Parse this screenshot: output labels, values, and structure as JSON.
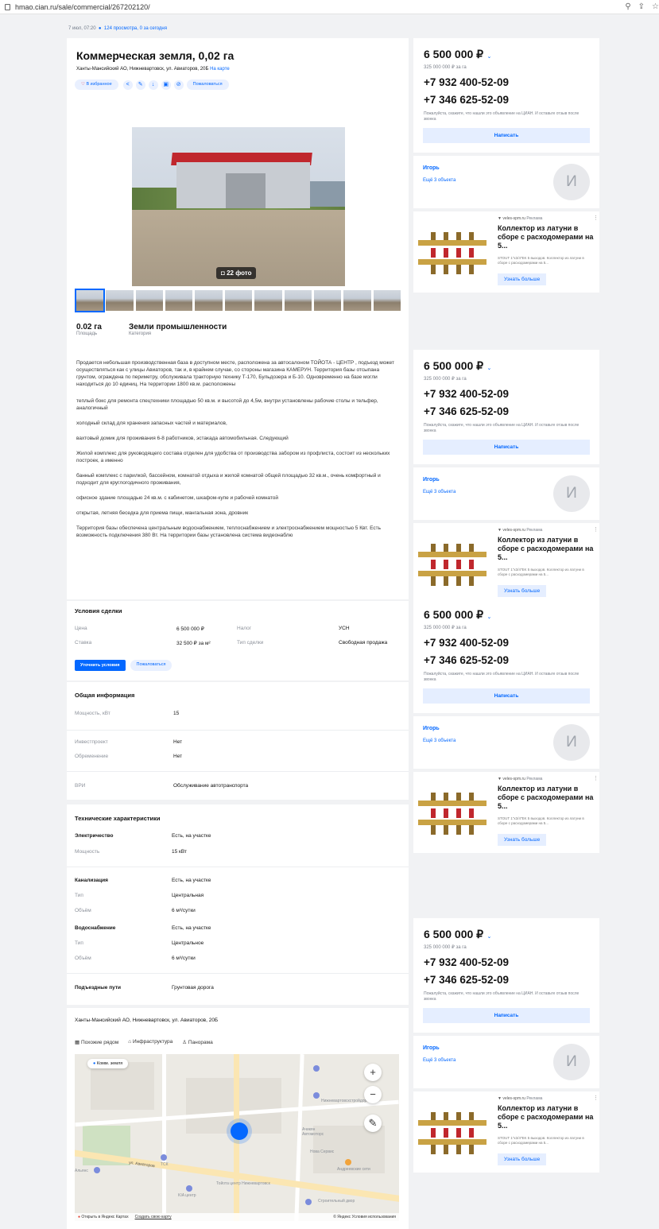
{
  "browser": {
    "url": "hmao.cian.ru/sale/commercial/267202120/"
  },
  "meta": {
    "date": "7 июл, 07:20",
    "views": "124 просмотра, 0 за сегодня"
  },
  "listing": {
    "title": "Коммерческая земля, 0,02 га",
    "address": "Ханты-Мансийский АО, Нижневартовск, ул. Авиаторов, 20Б",
    "map_link": "На карте",
    "favorite": "В избранное",
    "complain": "Пожаловаться",
    "photo_count": "22 фото",
    "area_value": "0.02 га",
    "area_label": "Площадь",
    "category_value": "Земли промышленности",
    "category_label": "Категория"
  },
  "description": [
    "Продается небольшая производственная база в доступном месте, расположена за автосалоном ТОЙОТА - ЦЕНТР , подъезд может осуществляться как с улицы Авиаторов, так и, в крайнем случае, со стороны магазина КАМЕРУН. Территория базы отсыпана грунтом, ограждена по периметру, обслуживала тракторную технику Т-170, Бульдозера и Б-10. Одновременно на базе могли находиться до 10 единиц. На территории 1800 кв.м. расположены",
    "теплый бокс для ремонта спецтехники площадью 50 кв.м. и высотой до 4,5м, внутри установлены рабочие столы и тельфер, аналогичный",
    "холодный склад для хранения запасных частей и материалов,",
    "вахтовый домик для проживания 6-8 работников, эстакада автомобильная. Следующий",
    "Жилой комплекс для руководящего состава отделен для удобства от производства забором из профлиста, состоит из нескольких построек, а именно",
    "банный комплекс с парилкой, бассейном, комнатой отдыха и жилой комнатой общей площадью 32 кв.м., очень комфортный и подходит для круглогодичного проживания,",
    "офисное здание площадью 24 кв.м. с кабинетом, шкафом-купе и рабочей комнатой",
    "открытая, летняя беседка для приема пищи, мангальная зона, дровник",
    "Территория базы обеспечена центральным водоснабжением, теплоснабжением и электроснабжением мощностью 5 Квт. Есть возможность подключения 380 Вт. На территории базы установлена система видеонаблю"
  ],
  "deal": {
    "title": "Условия сделки",
    "price_label": "Цена",
    "price": "6 500 000 ₽",
    "tax_label": "Налог",
    "tax": "УСН",
    "rate_label": "Ставка",
    "rate": "32 500 ₽ за м²",
    "type_label": "Тип сделки",
    "type": "Свободная продажа",
    "clarify": "Уточнить условия",
    "complain": "Пожаловаться"
  },
  "general": {
    "title": "Общая информация",
    "power_label": "Мощность, кВт",
    "power": "15",
    "invest_label": "Инвестпроект",
    "invest": "Нет",
    "burden_label": "Обременение",
    "burden": "Нет",
    "vri_label": "ВРИ",
    "vri": "Обслуживание автотранспорта"
  },
  "tech": {
    "title": "Технические характеристики",
    "el_label": "Электричество",
    "el": "Есть, на участке",
    "el_power_label": "Мощность",
    "el_power": "15 кВт",
    "sew_label": "Канализация",
    "sew": "Есть, на участке",
    "sew_type_label": "Тип",
    "sew_type": "Центральная",
    "sew_vol_label": "Объём",
    "sew_vol": "6 м³/сутки",
    "water_label": "Водоснабжение",
    "water": "Есть, на участке",
    "water_type_label": "Тип",
    "water_type": "Центральное",
    "water_vol_label": "Объём",
    "water_vol": "6 м³/сутки",
    "roads_label": "Подъездные пути",
    "roads": "Грунтовая дорога"
  },
  "map": {
    "address": "Ханты-Мансийский АО, Нижневартовск, ул. Авиаторов, 20Б",
    "tab_similar": "Похожие рядом",
    "tab_infra": "Инфраструктура",
    "tab_panorama": "Панорама",
    "chip": "Комм. земля",
    "open_yandex": "Открыть в Яндекс Картах",
    "create_map": "Создать свою карту",
    "terms": "© Яндекс Условия использования",
    "label_ul": "ул. Авиаторов",
    "label_toyota": "Тойота центр Нижневартовск",
    "label_nvs": "Нижневартовскстройдор",
    "label_auto": "Ачикян Автомоторс",
    "label_kia": "KIA центр",
    "label_andr": "Андреевские сети",
    "label_stroi": "Строительный двор",
    "label_nova": "Нова Сервис",
    "label_tsk": "ТСК",
    "label_alyans": "Альянс"
  },
  "sidebar": {
    "price": "6 500 000 ₽",
    "price_per": "325 000 000 ₽ за га",
    "phone1": "+7 932 400-52-09",
    "phone2": "+7 346 625-52-09",
    "note": "Пожалуйста, скажите, что нашли это объявление на ЦИАН. И оставьте отзыв после звонка",
    "write": "Написать",
    "agent": "Игорь",
    "agent_more": "Ещё 3 объекта",
    "avatar_letter": "И"
  },
  "ad": {
    "domain": "veles-spm.ru",
    "tag": "Реклама",
    "title": "Коллектор из латуни в сборе с расходомерами на 5...",
    "text": "STOUT 1\"x3/4\"EK 5 выходов. Коллектор из латуни в сборе с расходомерами на 5...",
    "button": "Узнать больше"
  },
  "colors": {
    "accent": "#0468ff",
    "accent_bg": "#e9f0ff",
    "roof": "#c0272d"
  }
}
